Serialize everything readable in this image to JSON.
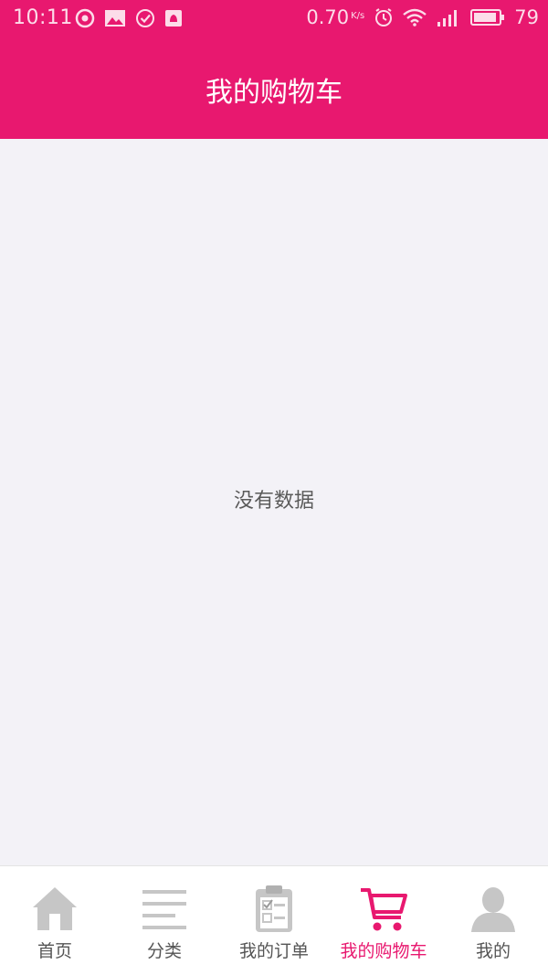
{
  "status_bar": {
    "time": "10:11",
    "net_speed": "0.70",
    "net_unit": "K/s",
    "battery": "79",
    "left_icons": [
      "sync-icon",
      "image-icon",
      "check-circle-icon",
      "app-notification-icon"
    ],
    "right_icons": [
      "alarm-icon",
      "wifi-icon",
      "signal-4g-icon",
      "battery-icon"
    ]
  },
  "header": {
    "title": "我的购物车"
  },
  "main": {
    "empty_text": "没有数据"
  },
  "tabbar": {
    "items": [
      {
        "label": "首页",
        "icon": "home-icon"
      },
      {
        "label": "分类",
        "icon": "category-list-icon"
      },
      {
        "label": "我的订单",
        "icon": "order-clipboard-icon"
      },
      {
        "label": "我的购物车",
        "icon": "shopping-cart-icon"
      },
      {
        "label": "我的",
        "icon": "user-profile-icon"
      }
    ],
    "active_index": 3
  },
  "colors": {
    "brand": "#e8186f",
    "background": "#f3f2f7",
    "tab_inactive_icon": "#c6c6c6",
    "tab_inactive_label": "#555555"
  }
}
